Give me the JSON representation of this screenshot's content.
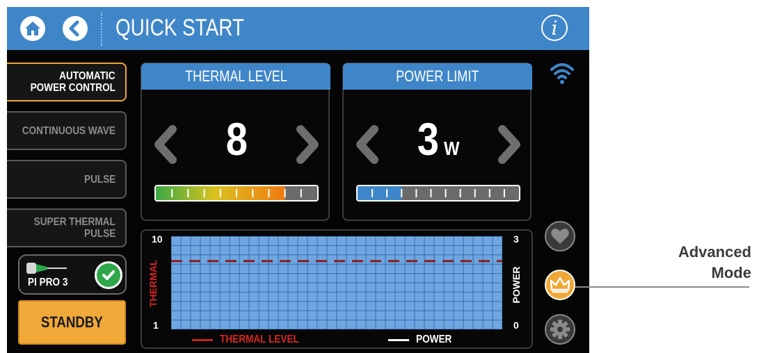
{
  "header": {
    "title": "QUICK START",
    "home_icon": "home-icon",
    "back_icon": "back-arrow-icon",
    "info_label": "i"
  },
  "modes": [
    {
      "label_line1": "AUTOMATIC",
      "label_line2": "POWER CONTROL",
      "active": true
    },
    {
      "label_line1": "CONTINUOUS WAVE",
      "label_line2": "",
      "active": false
    },
    {
      "label_line1": "PULSE",
      "label_line2": "",
      "active": false
    },
    {
      "label_line1": "SUPER THERMAL",
      "label_line2": "PULSE",
      "active": false
    }
  ],
  "probe": {
    "label": "PI PRO 3",
    "status": "connected"
  },
  "standby_label": "STANDBY",
  "thermal": {
    "title": "THERMAL LEVEL",
    "value": "8",
    "level": 8,
    "max": 10
  },
  "power": {
    "title": "POWER LIMIT",
    "value": "3",
    "unit": "W",
    "level": 3,
    "max": 11
  },
  "chart": {
    "thermal_axis_label": "THERMAL",
    "power_axis_label": "POWER",
    "thermal_max": "10",
    "thermal_min": "1",
    "power_max": "3",
    "power_min": "0",
    "legend_thermal": "THERMAL LEVEL",
    "legend_power": "POWER",
    "thermal_line_level": 8
  },
  "callout": {
    "line1": "Advanced",
    "line2": "Mode"
  },
  "colors": {
    "accent": "#3f86c9",
    "standby": "#f0a838",
    "thermal_line": "#8b1c1c",
    "check": "#2ea84a",
    "grid_fill": "#6fa6df",
    "grid_line": "#2f6fb4"
  }
}
